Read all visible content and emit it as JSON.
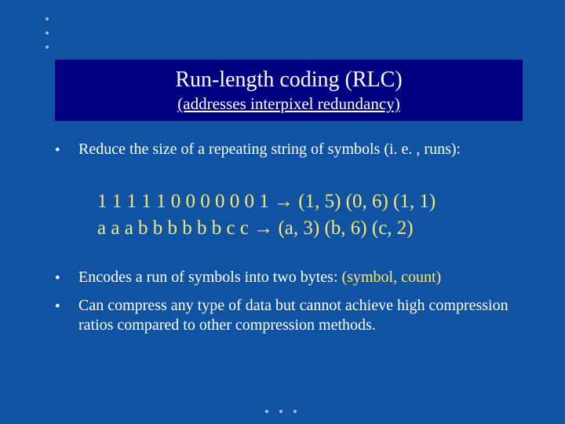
{
  "title": {
    "main": "Run-length coding (RLC)",
    "sub": "(addresses interpixel redundancy)"
  },
  "bullets": {
    "b1": "Reduce the size of a repeating string of symbols (i. e. , runs):",
    "b2_a": "Encodes a run of symbols into two bytes: ",
    "b2_b": "(symbol, count)",
    "b3": "Can compress any type of data but cannot achieve high compression ratios compared to other compression methods."
  },
  "examples": {
    "line1": "1 1 1 1 1 0 0 0 0 0 0 1 → (1, 5) (0, 6) (1, 1)",
    "line2": "a a a b b b b b b c c → (a, 3) (b, 6) (c, 2)"
  },
  "colors": {
    "background": "#1053a2",
    "band": "#000080",
    "accent": "#fbe96f",
    "text": "#ffffff"
  }
}
